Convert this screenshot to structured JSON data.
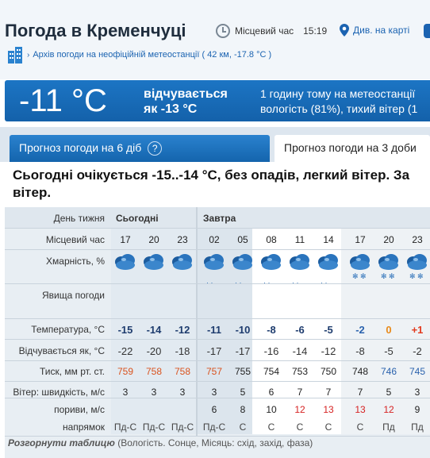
{
  "header": {
    "title": "Погода в Кременчуці",
    "local_time_label": "Місцевий час",
    "local_time_value": "15:19",
    "map_link": "Див. на карті",
    "archive_link": "Архів погоди на неофіційній метеостанції ( 42 км, -17.8 °C )"
  },
  "current": {
    "temperature": "-11 °C",
    "feels_line1": "відчувається",
    "feels_line2": "як -13 °C",
    "station_line1": "1 годину тому на метеостанції",
    "station_line2": "вологість (81%), тихий вітер (1"
  },
  "tabs": {
    "forecast_6": "Прогноз погоди на 6 діб",
    "help": "?",
    "forecast_3": "Прогноз погоди на 3 доби"
  },
  "summary": {
    "line1": "Сьогодні очікується -15..-14 °C, без опадів, легкий вітер. За",
    "line2": "вітер."
  },
  "table": {
    "labels": {
      "day": "День тижня",
      "time": "Місцевий час",
      "cloud": "Хмарність, %",
      "phenomena": "Явища погоди",
      "temp": "Температура, °C",
      "feels": "Відчувається як, °C",
      "pressure": "Тиск, мм рт. ст.",
      "wind": "Вітер: швидкість, м/с",
      "gusts": "пориви, м/с",
      "direction": "напрямок"
    },
    "days": [
      "Сьогодні",
      "Завтра"
    ],
    "times": [
      "17",
      "20",
      "23",
      "02",
      "05",
      "08",
      "11",
      "14",
      "17",
      "20",
      "23"
    ],
    "temps": [
      "-15",
      "-14",
      "-12",
      "-11",
      "-10",
      "-8",
      "-6",
      "-5",
      "-2",
      "0",
      "+1"
    ],
    "feels": [
      "-22",
      "-20",
      "-18",
      "-17",
      "-17",
      "-16",
      "-14",
      "-12",
      "-8",
      "-5",
      "-2"
    ],
    "pressure": [
      "759",
      "758",
      "758",
      "757",
      "755",
      "754",
      "753",
      "750",
      "748",
      "746",
      "745"
    ],
    "wind": [
      "3",
      "3",
      "3",
      "3",
      "5",
      "6",
      "7",
      "7",
      "7",
      "5",
      "3"
    ],
    "gusts": [
      "",
      "",
      "",
      "6",
      "8",
      "10",
      "12",
      "13",
      "13",
      "12",
      "9"
    ],
    "direction": [
      "Пд-С",
      "Пд-С",
      "Пд-С",
      "Пд-С",
      "С",
      "С",
      "С",
      "С",
      "С",
      "Пд",
      "Пд"
    ],
    "footer_bold": "Розгорнути таблицю",
    "footer_rest": " (Вологість. Сонце, Місяць: схід, захід, фаза)"
  },
  "colors": {
    "accent": "#1b63b1",
    "current_bg": "#1c75c4",
    "temp_red": "#e23b1f",
    "temp_orange": "#e88a1a",
    "pressure_red": "#d9531e",
    "gust_red": "#d62222",
    "pressure_blue": "#2a62ad"
  }
}
